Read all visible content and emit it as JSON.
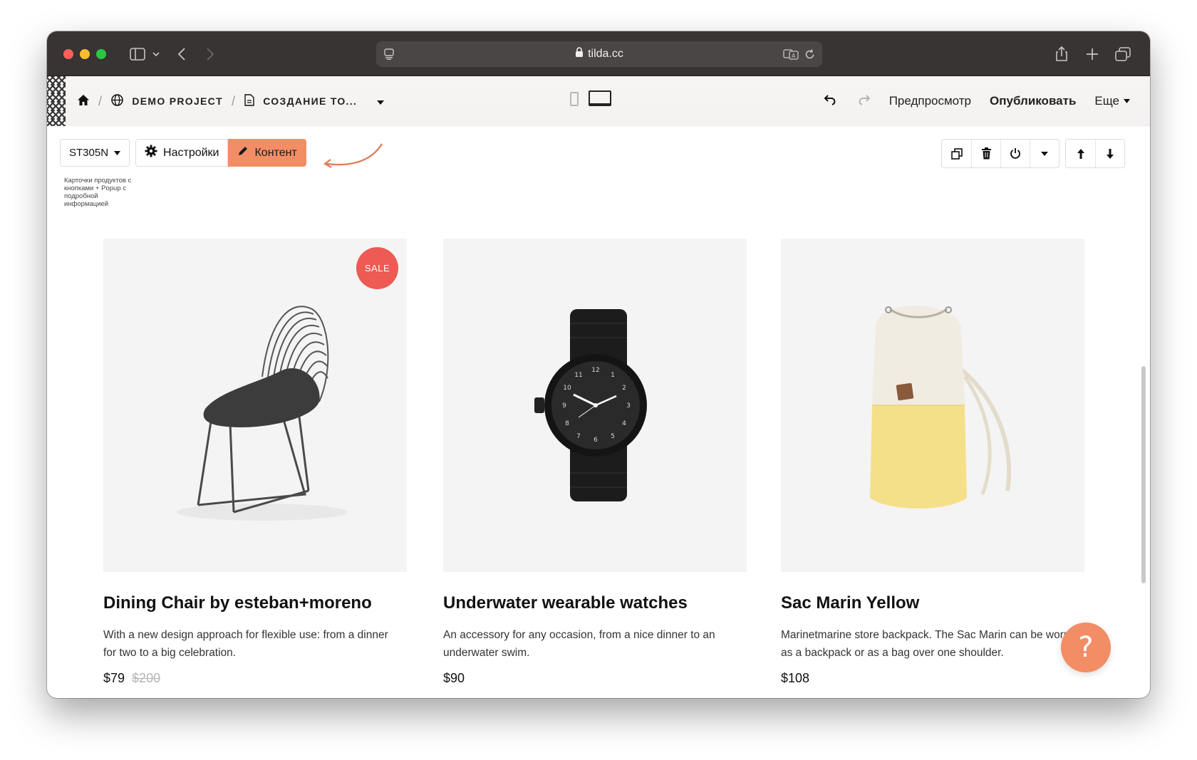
{
  "browser": {
    "url": "tilda.cc"
  },
  "breadcrumb": {
    "project": "DEMO PROJECT",
    "page": "СОЗДАНИЕ ТО..."
  },
  "header_actions": {
    "preview": "Предпросмотр",
    "publish": "Опубликовать",
    "more": "Еще"
  },
  "block": {
    "id": "ST305N",
    "settings_label": "Настройки",
    "content_label": "Контент",
    "description": "Карточки продуктов с кнопками + Popup с подробной информацией"
  },
  "products": [
    {
      "title": "Dining Chair by esteban+moreno",
      "description": "With a new design approach for flexible use: from a dinner for two to a big celebration.",
      "price": "$79",
      "old_price": "$200",
      "badge": "SALE"
    },
    {
      "title": "Underwater wearable watches",
      "description": "An accessory for any occasion, from a nice dinner to an underwater swim.",
      "price": "$90"
    },
    {
      "title": "Sac Marin Yellow",
      "description": "Marinetmarine store backpack. The Sac Marin can be worn as a backpack or as a bag over one shoulder.",
      "price": "$108"
    }
  ],
  "help": {
    "label": "?"
  },
  "colors": {
    "accent": "#f28d66",
    "sale": "#ee5a54",
    "titlebar": "#383433"
  }
}
